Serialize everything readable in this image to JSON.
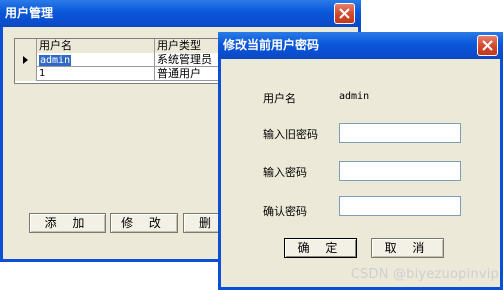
{
  "user_window": {
    "title": "用户管理",
    "grid": {
      "columns": [
        "用户名",
        "用户类型"
      ],
      "rows": [
        {
          "username": "admin",
          "type": "系统管理员"
        },
        {
          "username": "1",
          "type": "普通用户"
        }
      ]
    },
    "buttons": {
      "add": "添 加",
      "edit": "修 改",
      "delete": "删"
    }
  },
  "pwd_dialog": {
    "title": "修改当前用户密码",
    "username_label": "用户名",
    "username_value": "admin",
    "old_pwd_label": "输入旧密码",
    "new_pwd_label": "输入密码",
    "confirm_pwd_label": "确认密码",
    "ok_label": "确 定",
    "cancel_label": "取 消"
  },
  "watermark": "CSDN @biyezuopinvip"
}
